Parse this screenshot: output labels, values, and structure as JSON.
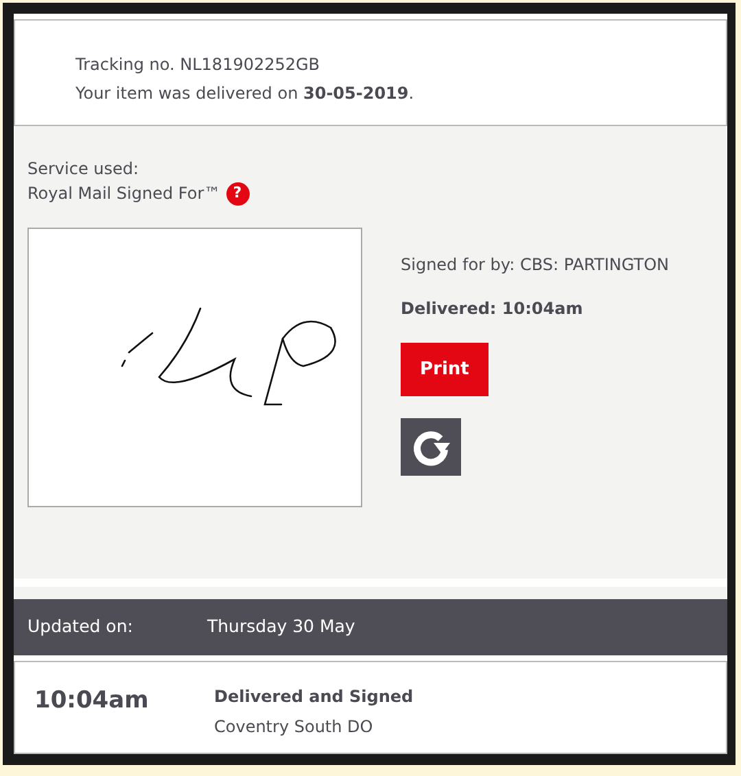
{
  "summary": {
    "tracking": "Tracking no. NL181902252GB",
    "delivered_text": "Your item was delivered on **30-05-2019**."
  },
  "service": {
    "label": "Service used:",
    "name": "Royal Mail Signed For™",
    "help": "?"
  },
  "proof": {
    "signed_by": "Signed for by: CBS: PARTINGTON",
    "delivered": "Delivered: 10:04am",
    "print_button": "Print"
  },
  "history": {
    "label": "Updated on:",
    "date": "Thursday 30 May",
    "events": [
      {
        "time": "10:04am",
        "status": "Delivered and Signed",
        "location": "Coventry South DO"
      }
    ]
  }
}
